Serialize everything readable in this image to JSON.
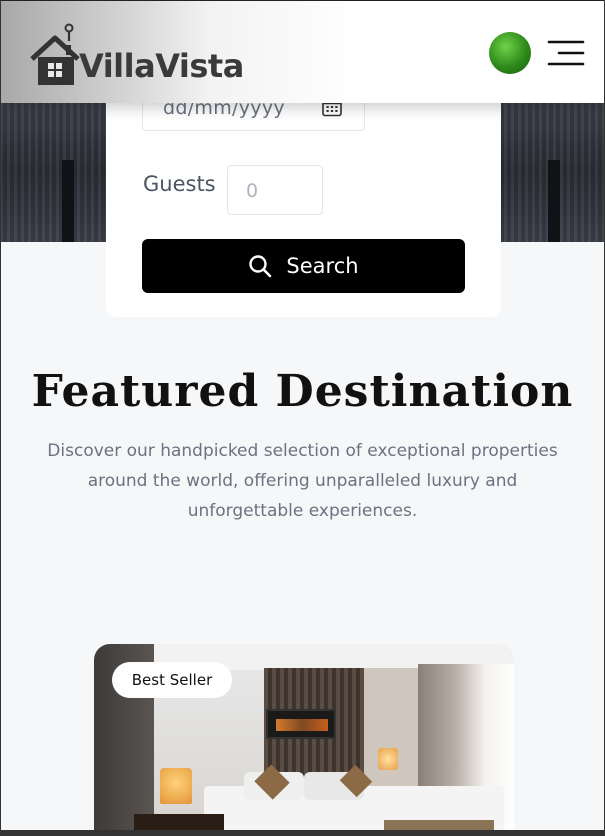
{
  "header": {
    "logo_text": "VillaVista",
    "avatar": "user-avatar",
    "menu_icon": "hamburger-menu-icon"
  },
  "search": {
    "date_placeholder": "dd/mm/yyyy",
    "calendar_icon": "calendar-icon",
    "guests_label": "Guests",
    "guests_placeholder": "0",
    "button_label": "Search",
    "button_icon": "search-icon"
  },
  "featured": {
    "title": "Featured Destination",
    "description": "Discover our handpicked selection of exceptional properties around the world, offering unparalleled luxury and unforgettable experiences."
  },
  "property": {
    "badge": "Best Seller"
  },
  "colors": {
    "button_bg": "#000000",
    "page_bg": "#f6f7f9",
    "card_bg": "#ffffff",
    "text_muted": "#6b7280"
  }
}
